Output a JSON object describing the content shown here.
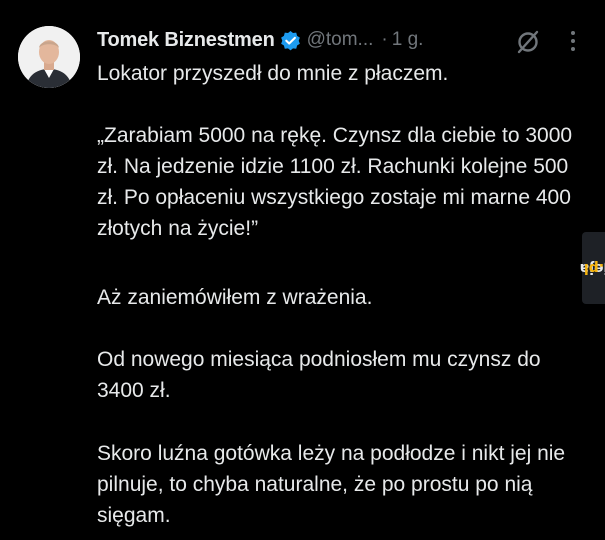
{
  "author": {
    "display_name": "Tomek Biznestmen",
    "handle": "@tom...",
    "separator": "·",
    "time": "1 g.",
    "verified_color": "#1d9bf0",
    "avatar_icon": "profile-photo"
  },
  "actions": {
    "grok_icon": "grok-slash-icon",
    "more_icon": "more-dots-icon"
  },
  "tweet": {
    "paragraphs": [
      "Lokator przyszedł do mnie z płaczem.",
      "„Zarabiam 5000 na rękę. Czynsz dla ciebie to 3000 zł. Na jedzenie idzie 1100 zł. Rachunki kolejne 500 zł. Po opłaceniu wszystkiego zostaje mi marne 400 złotych na życie!”",
      "Aż zaniemówiłem z wrażenia.",
      "Od nowego miesiąca podniosłem mu czynsz do 3400 zł.",
      "Skoro luźna gotówka leży na podłodze i nikt jej nie pilnuje, to chyba naturalne, że po prostu po nią sięgam."
    ]
  },
  "watermark": {
    "prefix": "jeja",
    "suffix": ".pl"
  },
  "colors": {
    "background": "#000000",
    "text": "#e7e9ea",
    "muted": "#71767b",
    "accent": "#1d9bf0"
  }
}
